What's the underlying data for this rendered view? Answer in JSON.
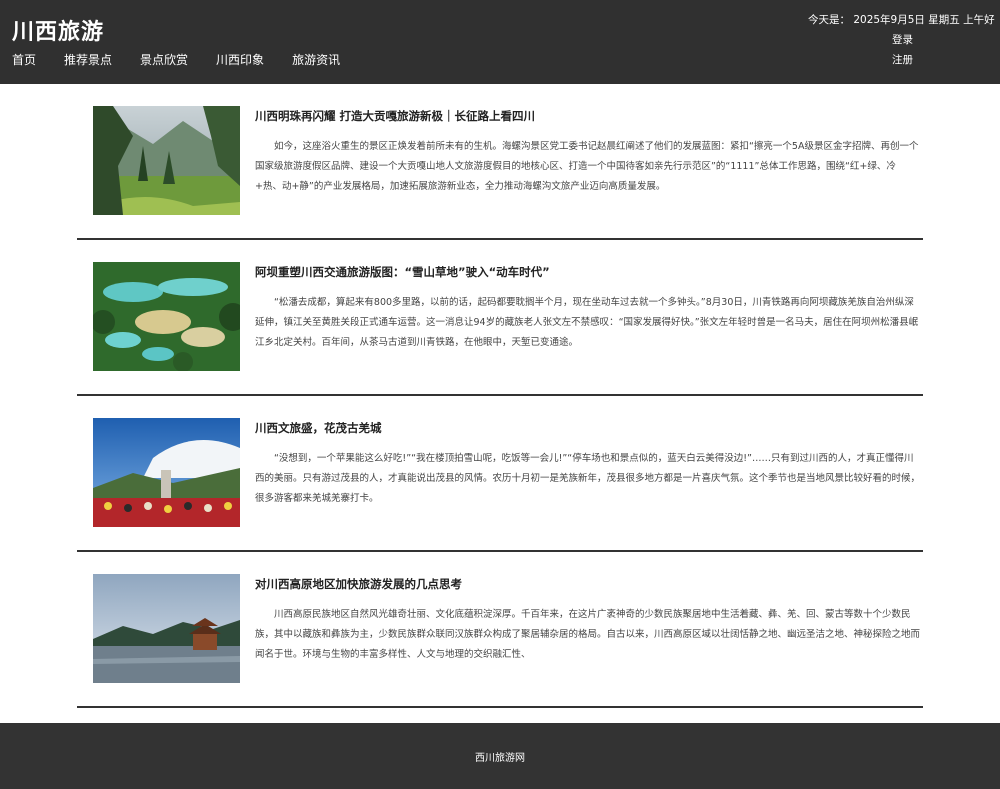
{
  "header": {
    "site_title": "川西旅游",
    "nav": [
      {
        "label": "首页"
      },
      {
        "label": "推荐景点"
      },
      {
        "label": "景点欣赏"
      },
      {
        "label": "川西印象"
      },
      {
        "label": "旅游资讯"
      }
    ],
    "date_text": "今天是： 2025年9月5日 星期五 上午好",
    "login_label": "登录",
    "register_label": "注册"
  },
  "articles": [
    {
      "title": "川西明珠再闪耀 打造大贡嘎旅游新极｜长征路上看四川",
      "body": "如今，这座浴火重生的景区正焕发着前所未有的生机。海螺沟景区党工委书记赵晨红阐述了他们的发展蓝图：紧扣“擦亮一个5A级景区金字招牌、再创一个国家级旅游度假区品牌、建设一个大贡嘎山地人文旅游度假目的地核心区、打造一个中国待客如亲先行示范区”的“1111”总体工作思路，围绕“红+绿、冷+热、动+静”的产业发展格局，加速拓展旅游新业态，全力推动海螺沟文旅产业迈向高质量发展。",
      "image": "forest-valley-photo"
    },
    {
      "title": "阿坝重塑川西交通旅游版图：“雪山草地”驶入“动车时代”",
      "body": "“松潘去成都，算起来有800多里路，以前的话，起码都要耽搁半个月，现在坐动车过去就一个多钟头。”8月30日，川青铁路再向阿坝藏族羌族自治州纵深延伸，镇江关至黄胜关段正式通车运营。这一消息让94岁的藏族老人张文左不禁感叹：“国家发展得好快。”张文左年轻时曾是一名马夫，居住在阿坝州松潘县岷江乡北定关村。百年间，从茶马古道到川青铁路，在他眼中，天堑已变通途。",
      "image": "turquoise-pools-photo"
    },
    {
      "title": "川西文旅盛，花茂古羌城",
      "body": "“没想到，一个苹果能这么好吃!”“我在楼顶拍雪山呢，吃饭等一会儿!”“停车场也和景点似的，蓝天白云美得没边!”……只有到过川西的人，才真正懂得川西的美丽。只有游过茂县的人，才真能说出茂县的风情。农历十月初一是羌族新年，茂县很多地方都是一片喜庆气氛。这个季节也是当地风景比较好看的时候，很多游客都来羌城羌寨打卡。",
      "image": "qiang-festival-photo"
    },
    {
      "title": "对川西高原地区加快旅游发展的几点思考",
      "body": "川西高原民族地区自然风光雄奇壮丽、文化底蕴积淀深厚。千百年来，在这片广袤神奇的少数民族聚居地中生活着藏、彝、羌、回、蒙古等数十个少数民族，其中以藏族和彝族为主，少数民族群众联同汉族群众构成了聚居辅杂居的格局。自古以来，川西高原区域以壮阔恬静之地、幽远圣洁之地、神秘探险之地而闻名于世。环境与生物的丰富多样性、人文与地理的交织融汇性、",
      "image": "lake-pavilion-photo"
    }
  ],
  "footer": {
    "text": "西川旅游网"
  },
  "colors": {
    "header_bg": "#303030",
    "footer_bg": "#333333",
    "divider": "#333333"
  }
}
